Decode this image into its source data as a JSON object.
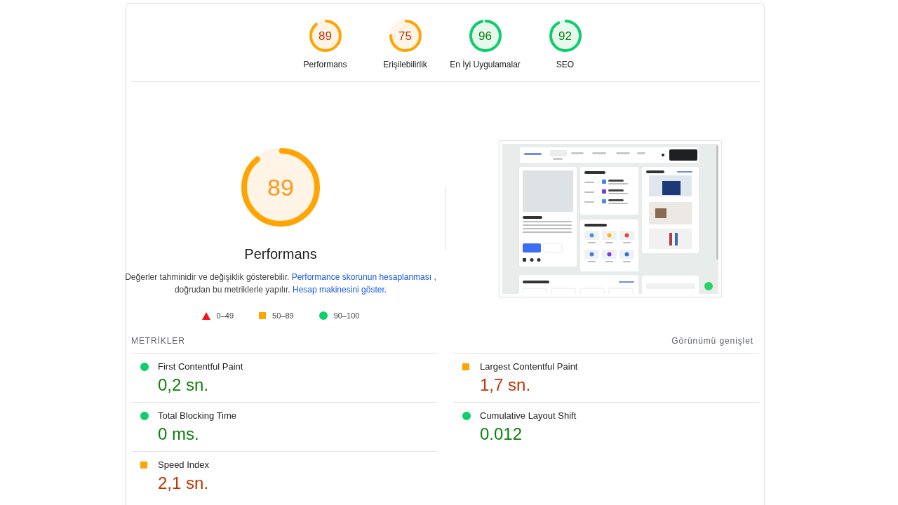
{
  "categories": [
    {
      "score": "89",
      "label": "Performans",
      "kind": "average"
    },
    {
      "score": "75",
      "label": "Erişilebilirlik",
      "kind": "average"
    },
    {
      "score": "96",
      "label": "En İyi Uygulamalar",
      "kind": "pass"
    },
    {
      "score": "92",
      "label": "SEO",
      "kind": "pass"
    }
  ],
  "performance": {
    "score": "89",
    "kind": "average",
    "title": "Performans",
    "description": [
      {
        "kind": "text",
        "text": "Değerler tahminidir ve değişiklik gösterebilir."
      },
      {
        "kind": "link",
        "text": "Performance skorunun hesaplanması"
      },
      {
        "kind": "text",
        "text": ", doğrudan bu metriklerle yapılır."
      },
      {
        "kind": "link",
        "text": "Hesap makinesini göster."
      }
    ]
  },
  "legend": [
    {
      "kind": "fail",
      "range": "0–49"
    },
    {
      "kind": "average",
      "range": "50–89"
    },
    {
      "kind": "pass",
      "range": "90–100"
    }
  ],
  "metrics": {
    "heading": "METRİKLER",
    "toggle": "Görünümü genişlet",
    "items": [
      {
        "title": "First Contentful Paint",
        "value": "0,2 sn.",
        "kind": "pass"
      },
      {
        "title": "Largest Contentful Paint",
        "value": "1,7 sn.",
        "kind": "average"
      },
      {
        "title": "Total Blocking Time",
        "value": "0 ms.",
        "kind": "pass"
      },
      {
        "title": "Cumulative Layout Shift",
        "value": "0.012",
        "kind": "pass"
      },
      {
        "title": "Speed Index",
        "value": "2,1 sn.",
        "kind": "average"
      }
    ]
  }
}
